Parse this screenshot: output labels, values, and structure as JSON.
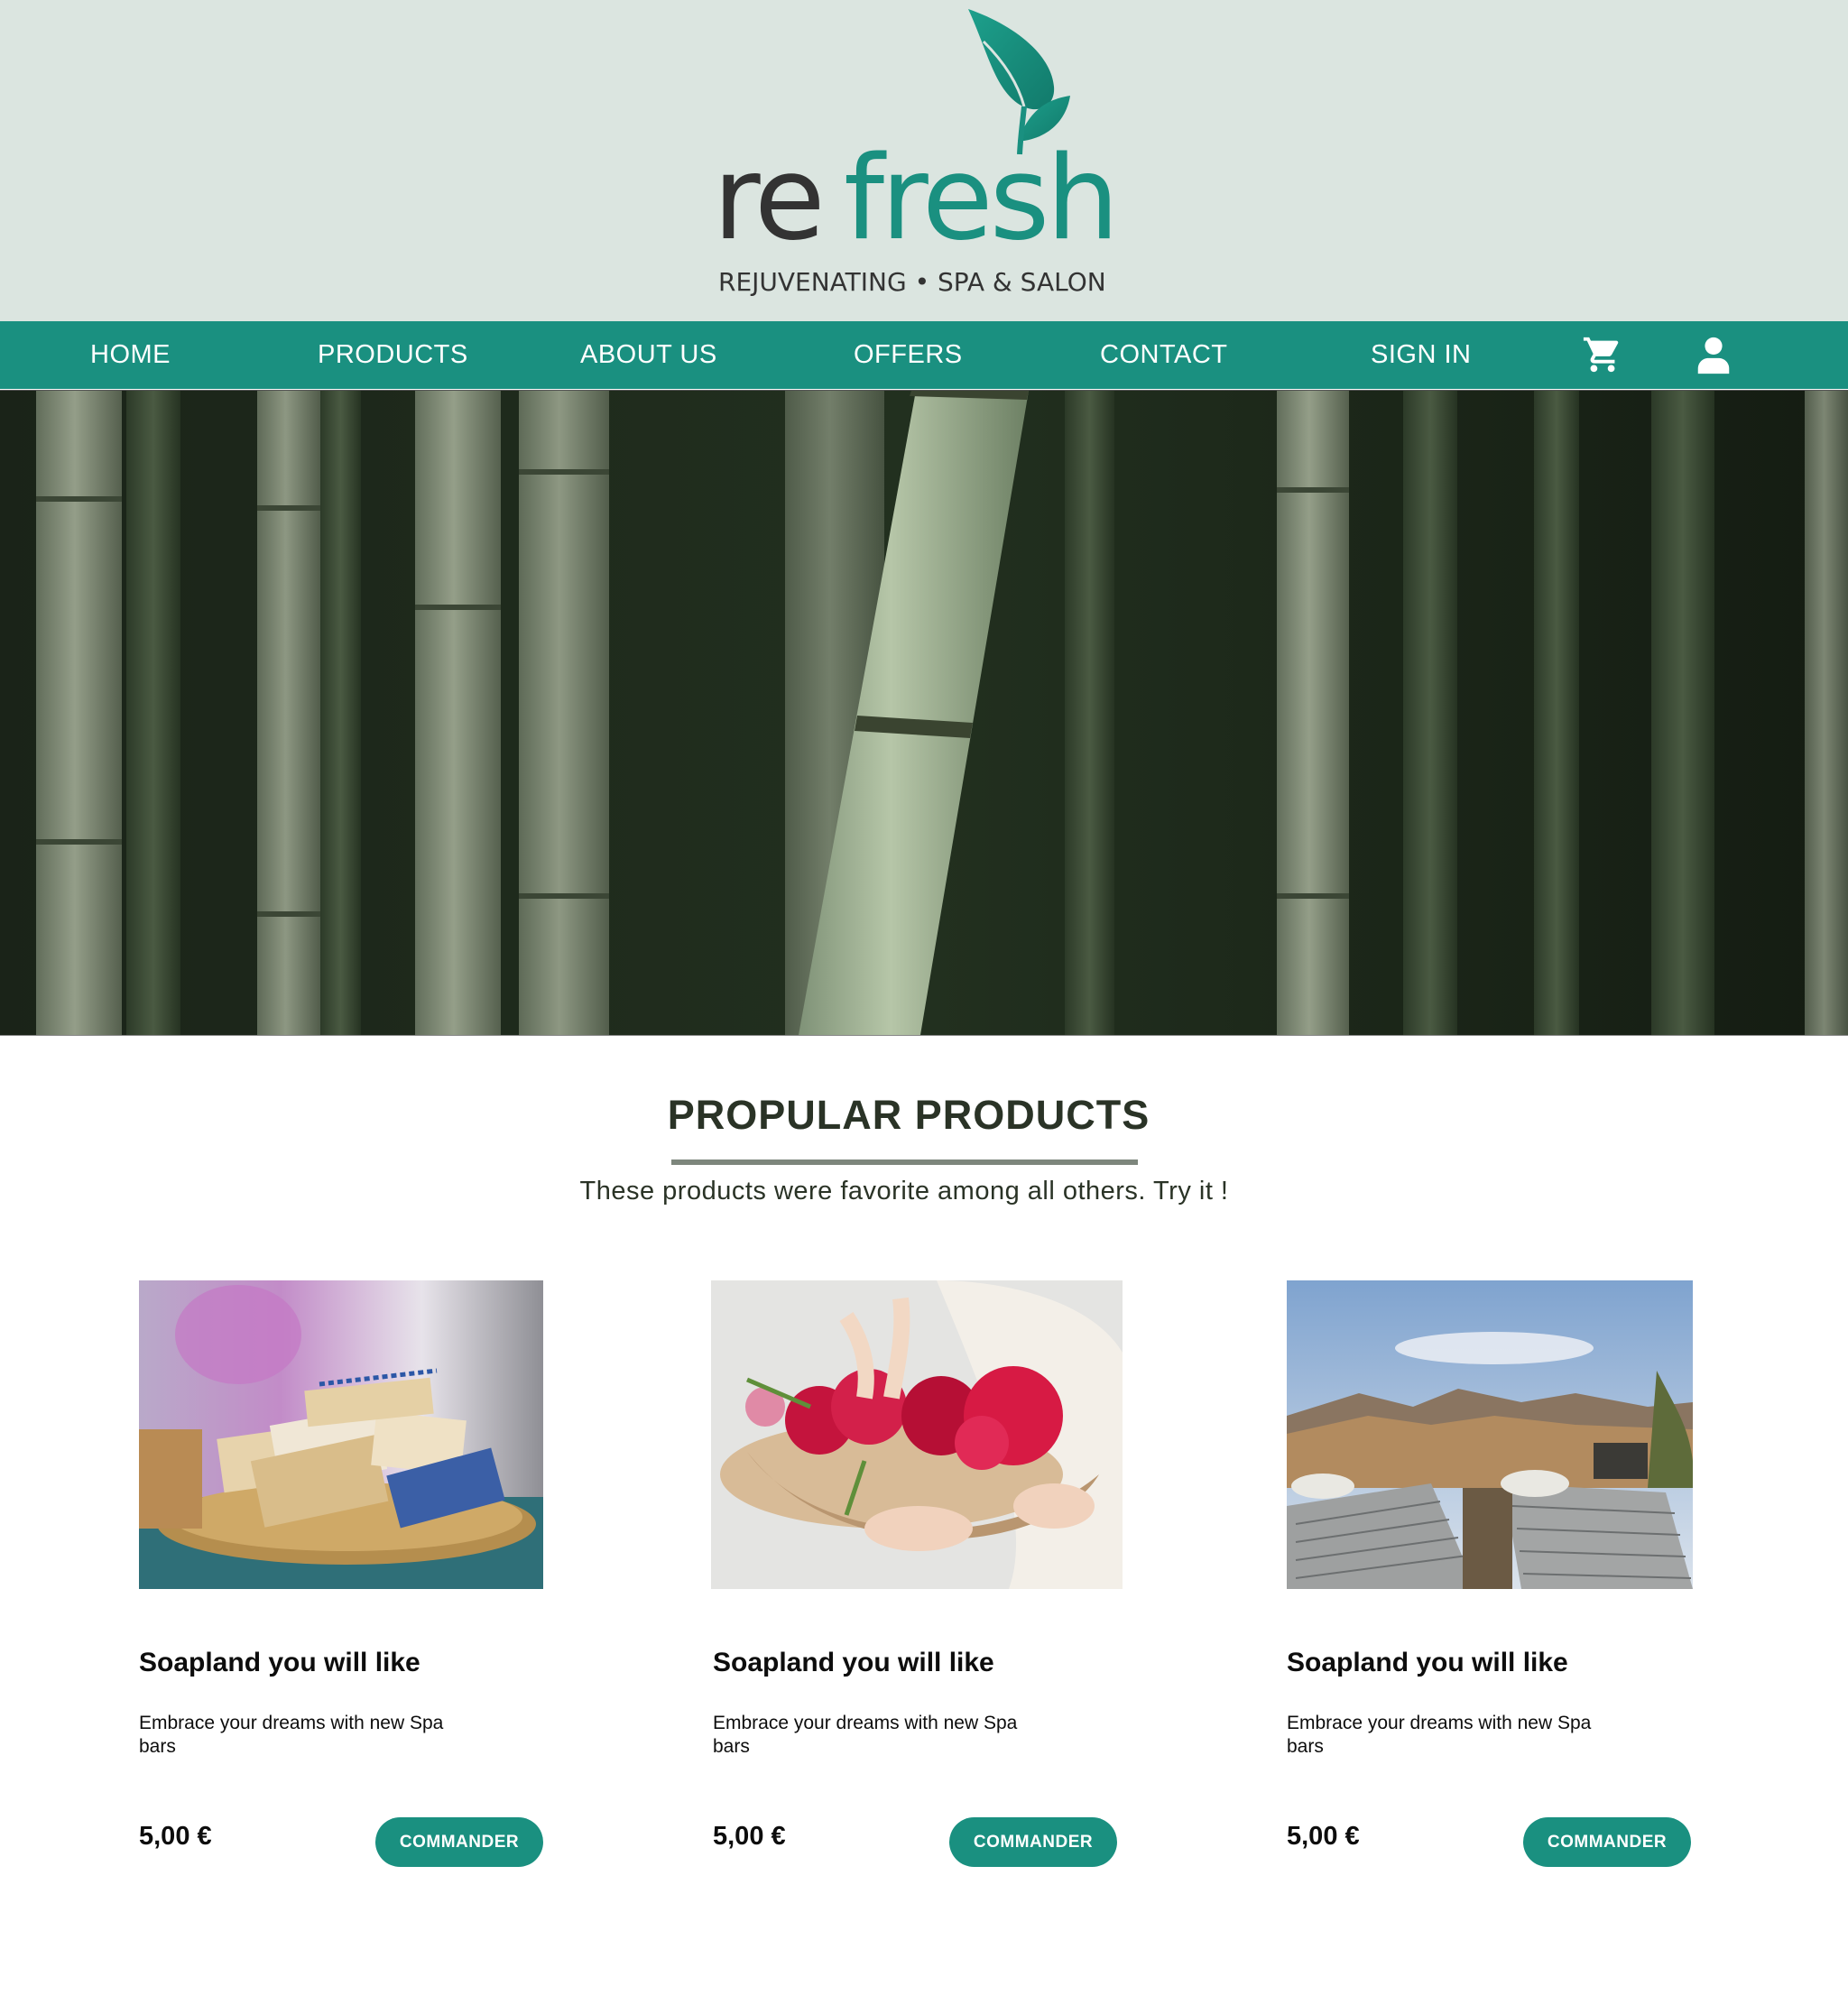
{
  "brand": {
    "name_part1": "re",
    "name_part2": "fresh",
    "tagline": "REJUVENATING • SPA & SALON",
    "colors": {
      "teal": "#1a9080",
      "dark": "#333333",
      "header_bg": "#dbe5e0"
    }
  },
  "nav": {
    "items": [
      {
        "label": "HOME"
      },
      {
        "label": "PRODUCTS"
      },
      {
        "label": "ABOUT US"
      },
      {
        "label": "OFFERS"
      },
      {
        "label": "CONTACT"
      },
      {
        "label": "SIGN IN"
      }
    ],
    "icons": [
      "cart-icon",
      "user-icon"
    ]
  },
  "hero": {
    "image": "bamboo-forest-photo"
  },
  "popular": {
    "title": "PROPULAR PRODUCTS",
    "subtitle": "These products were favorite among all others. Try it !"
  },
  "products": [
    {
      "image": "soap-bars-photo",
      "title": "Soapland you will like",
      "description": "Embrace your dreams with new Spa bars",
      "price": "5,00 €",
      "button": "COMMANDER"
    },
    {
      "image": "flower-bowl-photo",
      "title": "Soapland you will like",
      "description": "Embrace your dreams with new Spa bars",
      "price": "5,00 €",
      "button": "COMMANDER"
    },
    {
      "image": "spa-loungers-photo",
      "title": "Soapland you will like",
      "description": "Embrace your dreams with new Spa bars",
      "price": "5,00 €",
      "button": "COMMANDER"
    }
  ]
}
